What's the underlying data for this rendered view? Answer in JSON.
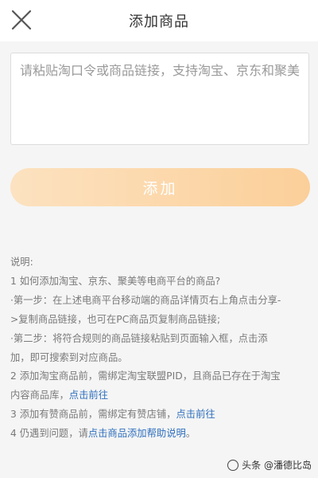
{
  "header": {
    "title": "添加商品",
    "close_icon": "close-icon"
  },
  "input": {
    "placeholder": "请粘贴淘口令或商品链接，支持淘宝、京东和聚美",
    "value": ""
  },
  "add_button": {
    "label": "添加",
    "gradient_from": "#fce2c0",
    "gradient_to": "#fbcf99"
  },
  "notes": {
    "heading": "说明:",
    "q1": "1 如何添加淘宝、京东、聚美等电商平台的商品?",
    "step1": "·第一步：在上述电商平台移动端的商品详情页右上角点击分享-",
    "step1_cont": ">复制商品链接，也可在PC商品页复制商品链接;",
    "step2": "·第二步：将符合规则的商品链接粘贴到页面输入框，点击添",
    "step2_cont": "加，即可搜索到对应商品。",
    "q2": "2 添加淘宝商品前，需绑定淘宝联盟PID，且商品已存在于淘宝",
    "q2_cont": "内容商品库，",
    "q2_link": "点击前往",
    "q3": "3 添加有赞商品前，需绑定有赞店铺，",
    "q3_link": "点击前往",
    "q4": "4 仍遇到问题，请",
    "q4_link": "点击商品添加帮助说明",
    "q4_end": "。",
    "link_color": "#2f6fbd"
  },
  "watermark": {
    "text": "头条 @潘德比岛"
  }
}
